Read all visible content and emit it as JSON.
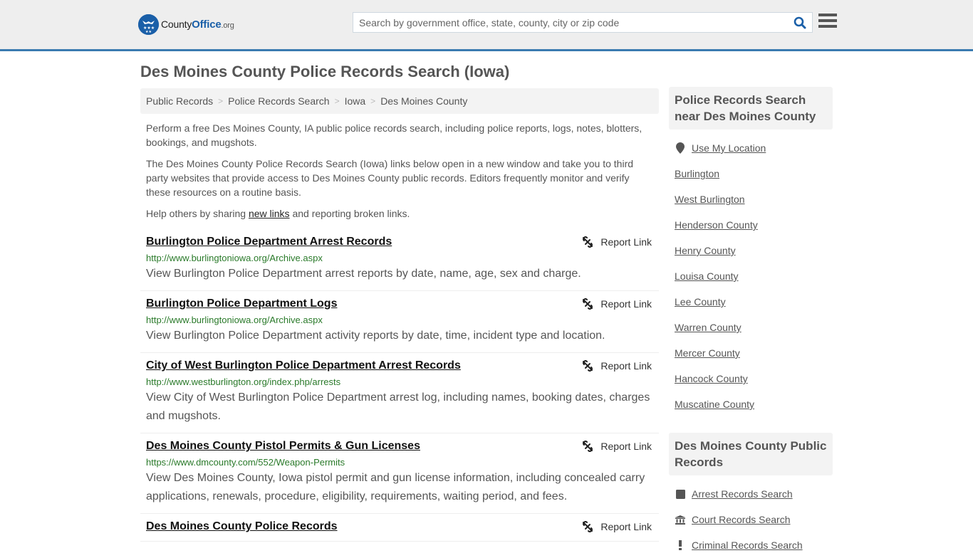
{
  "header": {
    "logo": {
      "name": "County",
      "name_bold": "Office",
      "tld": ".org"
    },
    "search": {
      "placeholder": "Search by government office, state, county, city or zip code",
      "value": ""
    }
  },
  "page": {
    "title": "Des Moines County Police Records Search (Iowa)",
    "breadcrumb": [
      "Public Records",
      "Police Records Search",
      "Iowa",
      "Des Moines County"
    ],
    "intro": {
      "p1": "Perform a free Des Moines County, IA public police records search, including police reports, logs, notes, blotters, bookings, and mugshots.",
      "p2": "The Des Moines County Police Records Search (Iowa) links below open in a new window and take you to third party websites that provide access to Des Moines County public records. Editors frequently monitor and verify these resources on a routine basis.",
      "p3_before": "Help others by sharing ",
      "p3_link": "new links",
      "p3_after": " and reporting broken links."
    },
    "report_label": "Report Link",
    "results": [
      {
        "title": "Burlington Police Department Arrest Records",
        "url": "http://www.burlingtoniowa.org/Archive.aspx",
        "desc": "View Burlington Police Department arrest reports by date, name, age, sex and charge."
      },
      {
        "title": "Burlington Police Department Logs",
        "url": "http://www.burlingtoniowa.org/Archive.aspx",
        "desc": "View Burlington Police Department activity reports by date, time, incident type and location."
      },
      {
        "title": "City of West Burlington Police Department Arrest Records",
        "url": "http://www.westburlington.org/index.php/arrests",
        "desc": "View City of West Burlington Police Department arrest log, including names, booking dates, charges and mugshots."
      },
      {
        "title": "Des Moines County Pistol Permits & Gun Licenses",
        "url": "https://www.dmcounty.com/552/Weapon-Permits",
        "desc": "View Des Moines County, Iowa pistol permit and gun license information, including concealed carry applications, renewals, procedure, eligibility, requirements, waiting period, and fees."
      },
      {
        "title": "Des Moines County Police Records",
        "url": "",
        "desc": ""
      }
    ]
  },
  "sidebar": {
    "nearby": {
      "heading": "Police Records Search near Des Moines County",
      "use_location": "Use My Location",
      "items": [
        "Burlington",
        "West Burlington",
        "Henderson County",
        "Henry County",
        "Louisa County",
        "Lee County",
        "Warren County",
        "Mercer County",
        "Hancock County",
        "Muscatine County"
      ]
    },
    "public_records": {
      "heading": "Des Moines County Public Records",
      "items": [
        {
          "label": "Arrest Records Search",
          "icon": "square-icon"
        },
        {
          "label": "Court Records Search",
          "icon": "courthouse-icon"
        },
        {
          "label": "Criminal Records Search",
          "icon": "exclamation-icon"
        }
      ]
    }
  },
  "colors": {
    "brand": "#1a5fa8",
    "header_border": "#3a7bb0",
    "url_green": "#2a7a2a"
  }
}
